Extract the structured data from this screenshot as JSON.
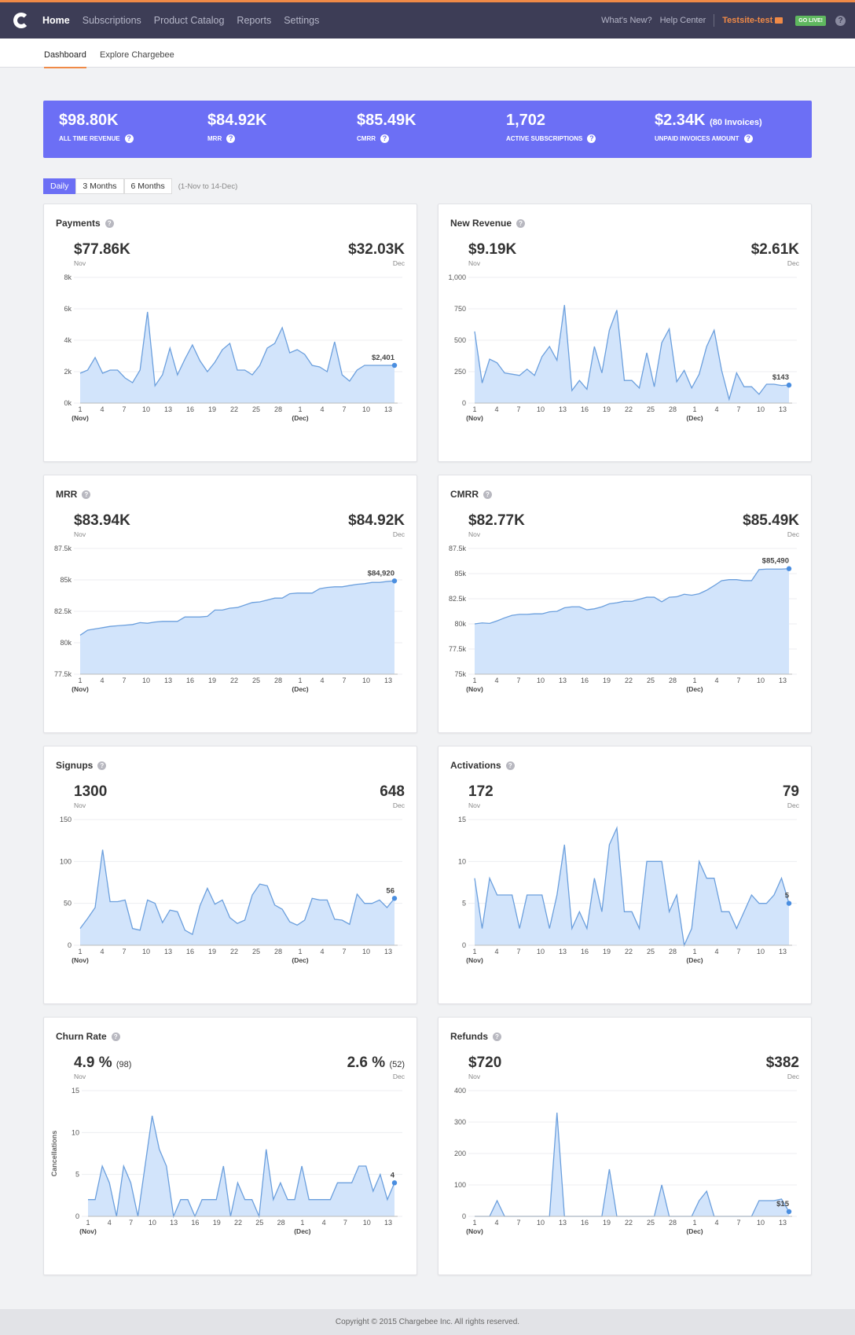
{
  "nav": {
    "items": [
      "Home",
      "Subscriptions",
      "Product Catalog",
      "Reports",
      "Settings"
    ],
    "whats_new": "What's New?",
    "help_center": "Help Center",
    "site": "Testsite-test",
    "go_live": "GO LIVE!"
  },
  "subnav": {
    "dashboard": "Dashboard",
    "explore": "Explore Chargebee"
  },
  "summary": [
    {
      "value": "$98.80K",
      "extra": "",
      "label": "ALL TIME REVENUE"
    },
    {
      "value": "$84.92K",
      "extra": "",
      "label": "MRR"
    },
    {
      "value": "$85.49K",
      "extra": "",
      "label": "CMRR"
    },
    {
      "value": "1,702",
      "extra": "",
      "label": "ACTIVE SUBSCRIPTIONS"
    },
    {
      "value": "$2.34K",
      "extra": "(80 Invoices)",
      "label": "UNPAID INVOICES AMOUNT"
    }
  ],
  "range": {
    "tabs": [
      "Daily",
      "3 Months",
      "6 Months"
    ],
    "active": "Daily",
    "note": "(1-Nov to 14-Dec)"
  },
  "x_ticks": [
    "1",
    "4",
    "7",
    "10",
    "13",
    "16",
    "19",
    "22",
    "25",
    "28",
    "1",
    "4",
    "7",
    "10",
    "13"
  ],
  "x_groups": [
    "(Nov)",
    "(Dec)"
  ],
  "colors": {
    "accent": "#6c6ff5",
    "nav": "#3d3d56",
    "orange": "#f08a47",
    "area": "#d2e4fb",
    "line": "#6b9fdd"
  },
  "cards": [
    {
      "title": "Payments",
      "left_value": "$77.86K",
      "left_extra": "",
      "left_period": "Nov",
      "right_value": "$32.03K",
      "right_extra": "",
      "right_period": "Dec",
      "last_label": "$2,401"
    },
    {
      "title": "New Revenue",
      "left_value": "$9.19K",
      "left_extra": "",
      "left_period": "Nov",
      "right_value": "$2.61K",
      "right_extra": "",
      "right_period": "Dec",
      "last_label": "$143"
    },
    {
      "title": "MRR",
      "left_value": "$83.94K",
      "left_extra": "",
      "left_period": "Nov",
      "right_value": "$84.92K",
      "right_extra": "",
      "right_period": "Dec",
      "last_label": "$84,920"
    },
    {
      "title": "CMRR",
      "left_value": "$82.77K",
      "left_extra": "",
      "left_period": "Nov",
      "right_value": "$85.49K",
      "right_extra": "",
      "right_period": "Dec",
      "last_label": "$85,490"
    },
    {
      "title": "Signups",
      "left_value": "1300",
      "left_extra": "",
      "left_period": "Nov",
      "right_value": "648",
      "right_extra": "",
      "right_period": "Dec",
      "last_label": "56"
    },
    {
      "title": "Activations",
      "left_value": "172",
      "left_extra": "",
      "left_period": "Nov",
      "right_value": "79",
      "right_extra": "",
      "right_period": "Dec",
      "last_label": "5"
    },
    {
      "title": "Churn Rate",
      "left_value": "4.9 %",
      "left_extra": "(98)",
      "left_period": "Nov",
      "right_value": "2.6 %",
      "right_extra": "(52)",
      "right_period": "Dec",
      "last_label": "4"
    },
    {
      "title": "Refunds",
      "left_value": "$720",
      "left_extra": "",
      "left_period": "Nov",
      "right_value": "$382",
      "right_extra": "",
      "right_period": "Dec",
      "last_label": "$15"
    }
  ],
  "chart_data": [
    {
      "type": "area",
      "title": "Payments",
      "ylabel": "",
      "ylim": [
        0,
        8000
      ],
      "yticks": [
        "0k",
        "2k",
        "4k",
        "6k",
        "8k"
      ],
      "values": [
        1900,
        2100,
        2900,
        1900,
        2100,
        2100,
        1600,
        1300,
        2100,
        5800,
        1100,
        1800,
        3500,
        1800,
        2800,
        3700,
        2700,
        2000,
        2600,
        3400,
        3800,
        2100,
        2100,
        1800,
        2400,
        3500,
        3800,
        4800,
        3200,
        3400,
        3100,
        2400,
        2300,
        2000,
        3900,
        1800,
        1400,
        2100,
        2400,
        2400,
        2400,
        2400,
        2401
      ]
    },
    {
      "type": "area",
      "title": "New Revenue",
      "ylabel": "",
      "ylim": [
        0,
        1000
      ],
      "yticks": [
        "0",
        "250",
        "500",
        "750",
        "1,000"
      ],
      "values": [
        570,
        160,
        350,
        320,
        240,
        230,
        220,
        270,
        220,
        370,
        450,
        340,
        780,
        100,
        180,
        110,
        450,
        240,
        580,
        740,
        180,
        180,
        120,
        400,
        130,
        480,
        590,
        170,
        260,
        120,
        230,
        450,
        580,
        260,
        30,
        240,
        130,
        130,
        70,
        150,
        150,
        140,
        143
      ]
    },
    {
      "type": "area",
      "title": "MRR",
      "ylabel": "",
      "ylim": [
        77500,
        87500
      ],
      "yticks": [
        "77.5k",
        "80k",
        "82.5k",
        "85k",
        "87.5k"
      ],
      "values": [
        80600,
        81000,
        81100,
        81200,
        81300,
        81350,
        81400,
        81450,
        81600,
        81550,
        81650,
        81700,
        81700,
        81700,
        82050,
        82050,
        82050,
        82100,
        82600,
        82600,
        82750,
        82800,
        83000,
        83200,
        83250,
        83400,
        83550,
        83550,
        83900,
        83950,
        83950,
        83950,
        84300,
        84400,
        84450,
        84450,
        84550,
        84650,
        84700,
        84800,
        84800,
        84870,
        84920
      ]
    },
    {
      "type": "area",
      "title": "CMRR",
      "ylabel": "",
      "ylim": [
        75000,
        87500
      ],
      "yticks": [
        "75k",
        "77.5k",
        "80k",
        "82.5k",
        "85k",
        "87.5k"
      ],
      "values": [
        80000,
        80100,
        80050,
        80300,
        80600,
        80850,
        80950,
        80950,
        81000,
        81000,
        81200,
        81250,
        81600,
        81700,
        81700,
        81400,
        81500,
        81700,
        82000,
        82100,
        82250,
        82250,
        82450,
        82650,
        82650,
        82200,
        82650,
        82700,
        82950,
        82850,
        83000,
        83350,
        83800,
        84300,
        84400,
        84400,
        84300,
        84300,
        85400,
        85450,
        85450,
        85450,
        85490
      ]
    },
    {
      "type": "area",
      "title": "Signups",
      "ylabel": "",
      "ylim": [
        0,
        150
      ],
      "yticks": [
        "0",
        "50",
        "100",
        "150"
      ],
      "values": [
        20,
        32,
        45,
        114,
        52,
        52,
        54,
        20,
        18,
        54,
        50,
        27,
        42,
        40,
        18,
        13,
        47,
        68,
        49,
        54,
        33,
        26,
        30,
        60,
        73,
        71,
        48,
        43,
        28,
        24,
        30,
        56,
        54,
        54,
        31,
        30,
        25,
        61,
        50,
        50,
        54,
        45,
        56
      ]
    },
    {
      "type": "area",
      "title": "Activations",
      "ylabel": "",
      "ylim": [
        0,
        15
      ],
      "yticks": [
        "0",
        "5",
        "10",
        "15"
      ],
      "values": [
        8,
        2,
        8,
        6,
        6,
        6,
        2,
        6,
        6,
        6,
        2,
        6,
        12,
        2,
        4,
        2,
        8,
        4,
        12,
        14,
        4,
        4,
        2,
        10,
        10,
        10,
        4,
        6,
        0,
        2,
        10,
        8,
        8,
        4,
        4,
        2,
        4,
        6,
        5,
        5,
        6,
        8,
        5
      ]
    },
    {
      "type": "area",
      "title": "Churn Rate",
      "ylabel": "Cancellations",
      "ylim": [
        0,
        15
      ],
      "yticks": [
        "0",
        "5",
        "10",
        "15"
      ],
      "values": [
        2,
        2,
        6,
        4,
        0,
        6,
        4,
        0,
        6,
        12,
        8,
        6,
        0,
        2,
        2,
        0,
        2,
        2,
        2,
        6,
        0,
        4,
        2,
        2,
        0,
        8,
        2,
        4,
        2,
        2,
        6,
        2,
        2,
        2,
        2,
        4,
        4,
        4,
        6,
        6,
        3,
        5,
        2,
        4
      ]
    },
    {
      "type": "area",
      "title": "Refunds",
      "ylabel": "",
      "ylim": [
        0,
        400
      ],
      "yticks": [
        "0",
        "100",
        "200",
        "300",
        "400"
      ],
      "values": [
        0,
        0,
        0,
        50,
        0,
        0,
        0,
        0,
        0,
        0,
        0,
        330,
        0,
        0,
        0,
        0,
        0,
        0,
        150,
        0,
        0,
        0,
        0,
        0,
        0,
        100,
        0,
        0,
        0,
        0,
        50,
        80,
        0,
        0,
        0,
        0,
        0,
        0,
        50,
        50,
        50,
        55,
        15
      ]
    }
  ],
  "footer": "Copyright © 2015 Chargebee Inc. All rights reserved."
}
